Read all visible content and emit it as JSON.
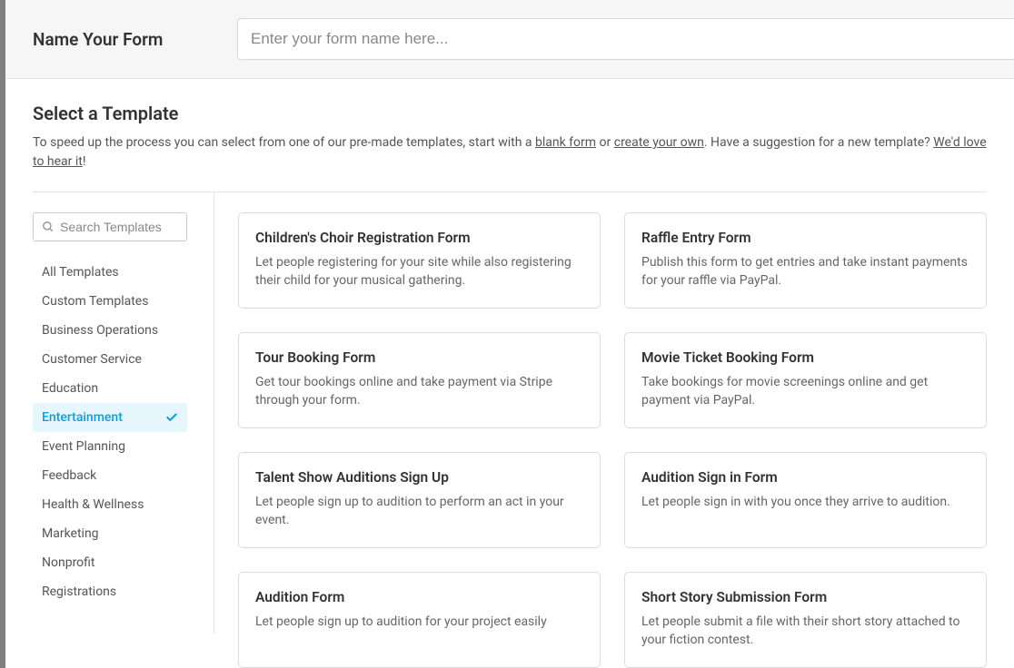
{
  "header": {
    "label": "Name Your Form",
    "placeholder": "Enter your form name here..."
  },
  "section": {
    "title": "Select a Template",
    "desc_1": "To speed up the process you can select from one of our pre-made templates, start with a ",
    "link_blank": "blank form",
    "desc_or": " or ",
    "link_create": "create your own",
    "desc_2": ". Have a suggestion for a new template? ",
    "link_hear": "We'd love to hear it",
    "desc_3": "!"
  },
  "search": {
    "placeholder": "Search Templates"
  },
  "categories": [
    {
      "label": "All Templates",
      "active": false
    },
    {
      "label": "Custom Templates",
      "active": false
    },
    {
      "label": "Business Operations",
      "active": false
    },
    {
      "label": "Customer Service",
      "active": false
    },
    {
      "label": "Education",
      "active": false
    },
    {
      "label": "Entertainment",
      "active": true
    },
    {
      "label": "Event Planning",
      "active": false
    },
    {
      "label": "Feedback",
      "active": false
    },
    {
      "label": "Health & Wellness",
      "active": false
    },
    {
      "label": "Marketing",
      "active": false
    },
    {
      "label": "Nonprofit",
      "active": false
    },
    {
      "label": "Registrations",
      "active": false
    }
  ],
  "templates": [
    {
      "title": "Children's Choir Registration Form",
      "desc": "Let people registering for your site while also registering their child for your musical gathering."
    },
    {
      "title": "Raffle Entry Form",
      "desc": "Publish this form to get entries and take instant payments for your raffle via PayPal."
    },
    {
      "title": "Tour Booking Form",
      "desc": "Get tour bookings online and take payment via Stripe through your form."
    },
    {
      "title": "Movie Ticket Booking Form",
      "desc": "Take bookings for movie screenings online and get payment via PayPal."
    },
    {
      "title": "Talent Show Auditions Sign Up",
      "desc": "Let people sign up to audition to perform an act in your event."
    },
    {
      "title": "Audition Sign in Form",
      "desc": "Let people sign in with you once they arrive to audition."
    },
    {
      "title": "Audition Form",
      "desc": "Let people sign up to audition for your project easily"
    },
    {
      "title": "Short Story Submission Form",
      "desc": "Let people submit a file with their short story attached to your fiction contest."
    }
  ]
}
